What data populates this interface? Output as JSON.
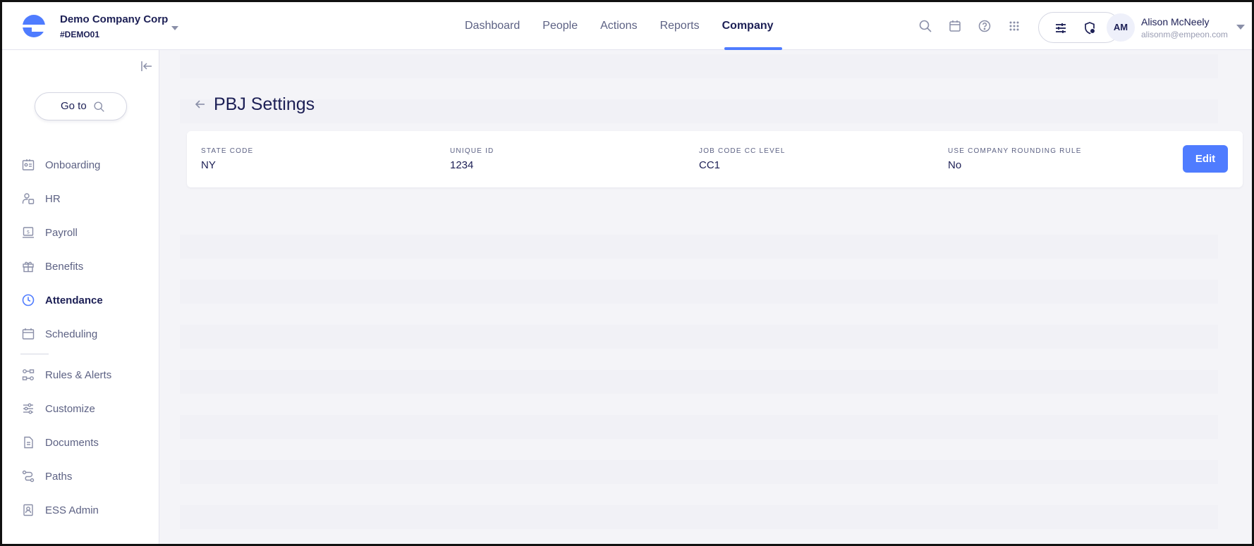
{
  "company": {
    "name": "Demo Company Corp",
    "code": "#DEMO01"
  },
  "nav": [
    "Dashboard",
    "People",
    "Actions",
    "Reports",
    "Company"
  ],
  "nav_active": "Company",
  "user": {
    "initials": "AM",
    "name": "Alison McNeely",
    "email": "alisonm@empeon.com"
  },
  "sidebar": {
    "goto_label": "Go to",
    "items": [
      {
        "label": "Onboarding",
        "icon": "onboarding-icon"
      },
      {
        "label": "HR",
        "icon": "hr-icon"
      },
      {
        "label": "Payroll",
        "icon": "payroll-icon"
      },
      {
        "label": "Benefits",
        "icon": "gift-icon"
      },
      {
        "label": "Attendance",
        "icon": "clock-icon"
      },
      {
        "label": "Scheduling",
        "icon": "calendar-icon"
      },
      {
        "label": "Rules & Alerts",
        "icon": "rules-icon"
      },
      {
        "label": "Customize",
        "icon": "sliders-icon"
      },
      {
        "label": "Documents",
        "icon": "document-icon"
      },
      {
        "label": "Paths",
        "icon": "paths-icon"
      },
      {
        "label": "ESS Admin",
        "icon": "badge-icon"
      }
    ],
    "active": "Attendance"
  },
  "page": {
    "title": "PBJ Settings",
    "fields": [
      {
        "label": "STATE CODE",
        "value": "NY"
      },
      {
        "label": "UNIQUE ID",
        "value": "1234"
      },
      {
        "label": "JOB CODE CC LEVEL",
        "value": "CC1"
      },
      {
        "label": "USE COMPANY ROUNDING RULE",
        "value": "No"
      }
    ],
    "edit_label": "Edit"
  },
  "colors": {
    "accent": "#4f7cff",
    "navy": "#1c1f55",
    "muted": "#5d6284",
    "background": "#f4f4f8"
  }
}
